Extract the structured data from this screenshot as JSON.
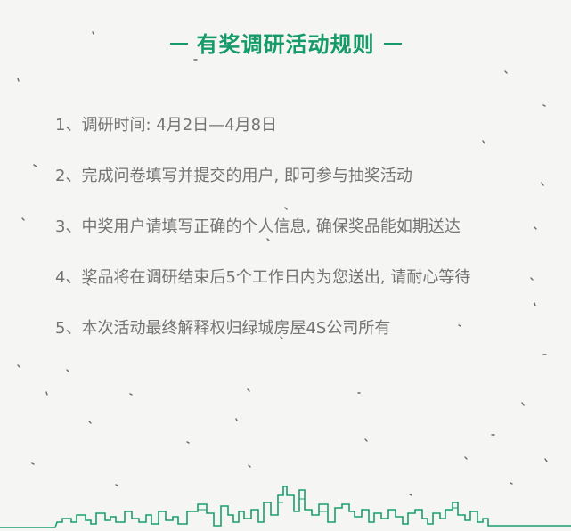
{
  "title": "有奖调研活动规则",
  "rules": [
    "1、调研时间: 4月2日—4月8日",
    "2、完成问卷填写并提交的用户, 即可参与抽奖活动",
    "3、中奖用户请填写正确的个人信息, 确保奖品能如期送达",
    "4、奖品将在调研结束后5个工作日内为您送出, 请耐心等待",
    "5、本次活动最终解释权归绿城房屋4S公司所有"
  ],
  "colors": {
    "accent": "#159a6a",
    "text": "#737373",
    "background": "#f5f5f3"
  }
}
